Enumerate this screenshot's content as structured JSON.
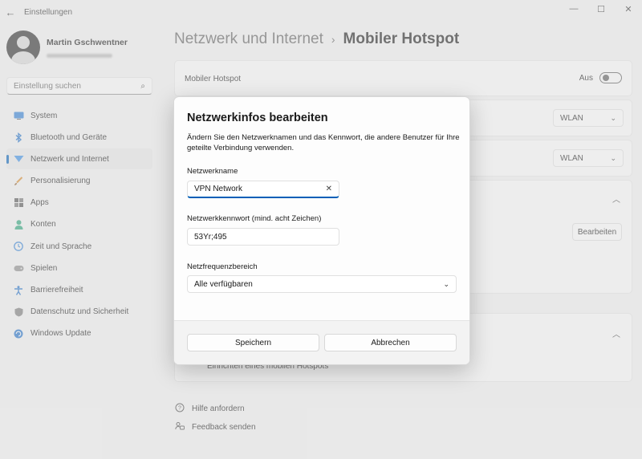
{
  "window": {
    "app_title": "Einstellungen",
    "controls": {
      "minimize": "—",
      "maximize": "☐",
      "close": "✕"
    }
  },
  "profile": {
    "name": "Martin Gschwentner"
  },
  "search": {
    "placeholder": "Einstellung suchen",
    "icon": "search-icon"
  },
  "sidebar": {
    "items": [
      {
        "label": "System",
        "icon": "system-icon",
        "active": false
      },
      {
        "label": "Bluetooth und Geräte",
        "icon": "bluetooth-icon",
        "active": false
      },
      {
        "label": "Netzwerk und Internet",
        "icon": "network-icon",
        "active": true
      },
      {
        "label": "Personalisierung",
        "icon": "brush-icon",
        "active": false
      },
      {
        "label": "Apps",
        "icon": "apps-icon",
        "active": false
      },
      {
        "label": "Konten",
        "icon": "account-icon",
        "active": false
      },
      {
        "label": "Zeit und Sprache",
        "icon": "globe-clock-icon",
        "active": false
      },
      {
        "label": "Spielen",
        "icon": "gamepad-icon",
        "active": false
      },
      {
        "label": "Barrierefreiheit",
        "icon": "accessibility-icon",
        "active": false
      },
      {
        "label": "Datenschutz und Sicherheit",
        "icon": "shield-icon",
        "active": false
      },
      {
        "label": "Windows Update",
        "icon": "update-icon",
        "active": false
      }
    ]
  },
  "breadcrumb": {
    "parent": "Netzwerk und Internet",
    "separator": "›",
    "current": "Mobiler Hotspot"
  },
  "main": {
    "hotspot_label": "Mobiler Hotspot",
    "hotspot_state": "Aus",
    "share_from_value": "WLAN",
    "share_over_value": "WLAN",
    "edit_button": "Bearbeiten",
    "setup_link": "Einrichten eines mobilen Hotspots"
  },
  "help": {
    "get_help": "Hilfe anfordern",
    "feedback": "Feedback senden"
  },
  "dialog": {
    "title": "Netzwerkinfos bearbeiten",
    "description": "Ändern Sie den Netzwerknamen und das Kennwort, die andere Benutzer für Ihre geteilte Verbindung verwenden.",
    "name_label": "Netzwerkname",
    "name_value": "VPN Network",
    "password_label": "Netzwerkkennwort (mind. acht Zeichen)",
    "password_value": "53Yr;495",
    "band_label": "Netzfrequenzbereich",
    "band_value": "Alle verfügbaren",
    "save_button": "Speichern",
    "cancel_button": "Abbrechen"
  },
  "colors": {
    "accent": "#005fb8",
    "window_bg": "#f3f3f3",
    "card_bg": "#fbfbfb"
  }
}
